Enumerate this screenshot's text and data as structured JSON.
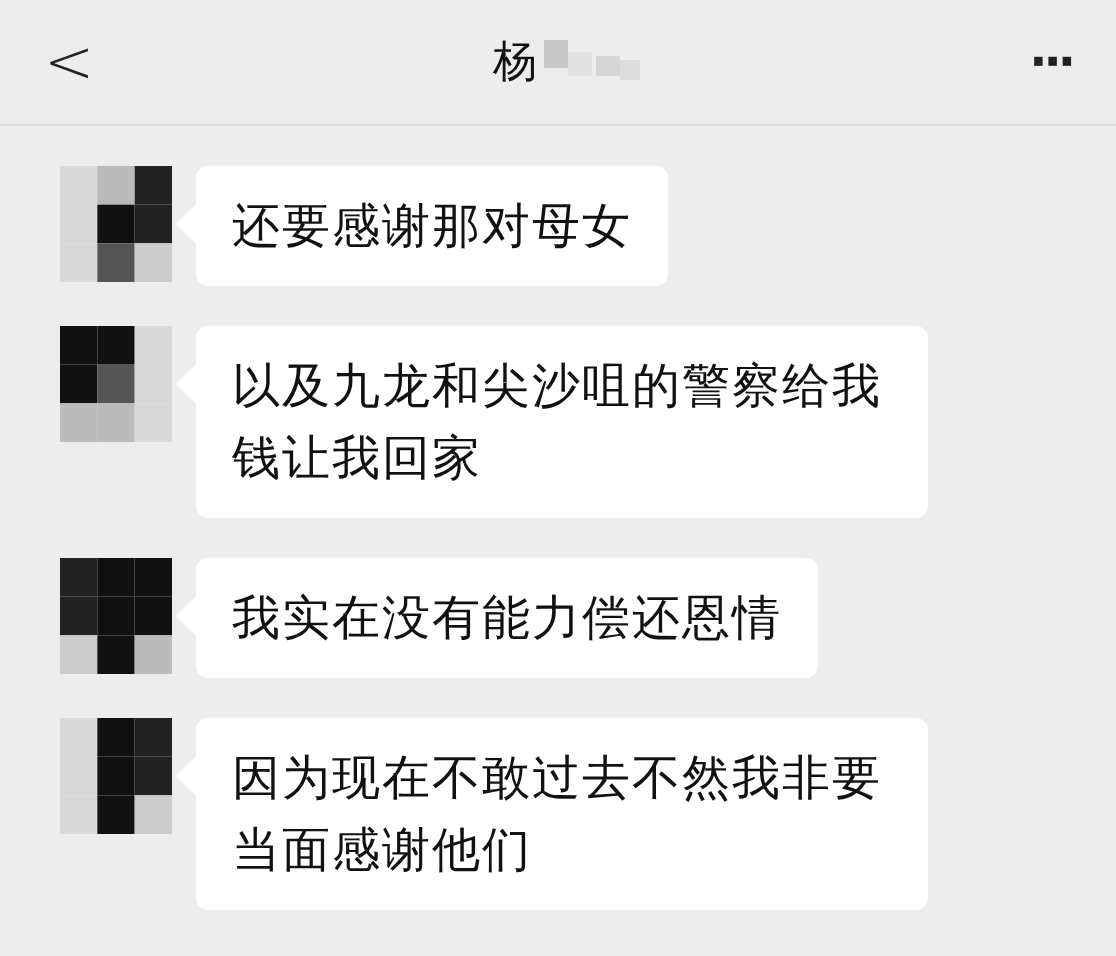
{
  "header": {
    "back": "<",
    "title": "杨",
    "more": "···"
  },
  "messages": [
    {
      "text": "还要感谢那对母女"
    },
    {
      "text": "以及九龙和尖沙咀的警察给我钱让我回家"
    },
    {
      "text": "我实在没有能力偿还恩情"
    },
    {
      "text": "因为现在不敢过去不然我非要当面感谢他们"
    }
  ]
}
